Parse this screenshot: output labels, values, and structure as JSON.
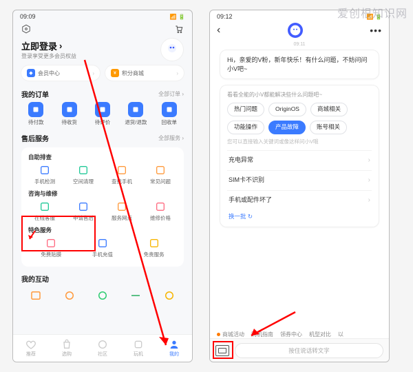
{
  "watermark": "爱创根知识网",
  "phone1": {
    "status": {
      "time": "09:09",
      "icons": "◎ ⇅ ✱ ⊕"
    },
    "login": {
      "title": "立即登录",
      "subtitle": "登录享受更多会员权益"
    },
    "pills": {
      "member": "会员中心",
      "points": "积分商城"
    },
    "orders": {
      "title": "我的订单",
      "more": "全部订单 ›",
      "items": [
        {
          "label": "待付款"
        },
        {
          "label": "待收货"
        },
        {
          "label": "待评价"
        },
        {
          "label": "退货/退款"
        },
        {
          "label": "回收单"
        }
      ]
    },
    "aftersale": {
      "title": "售后服务",
      "more": "全部服务 ›",
      "group1_title": "自助排查",
      "group1": [
        {
          "label": "手机检测"
        },
        {
          "label": "空间清理"
        },
        {
          "label": "查找手机"
        },
        {
          "label": "常见问题"
        }
      ],
      "group2_title": "咨询与维修",
      "group2": [
        {
          "label": "在线客服"
        },
        {
          "label": "申请售后"
        },
        {
          "label": "服务网点"
        },
        {
          "label": "维修价格"
        }
      ],
      "group3_title": "特色服务",
      "group3": [
        {
          "label": "免费贴膜"
        },
        {
          "label": "手机充值"
        },
        {
          "label": "免责服务"
        }
      ]
    },
    "interaction": {
      "title": "我的互动"
    },
    "tabs": [
      {
        "label": "推荐"
      },
      {
        "label": "选购"
      },
      {
        "label": "社区"
      },
      {
        "label": "玩机"
      },
      {
        "label": "我的"
      }
    ]
  },
  "phone2": {
    "status": {
      "time": "09:12",
      "icons": "◎ ⇅ ✱ ⊕"
    },
    "chat_time": "09:11",
    "greeting": "Hi，亲爱的V粉，新年快乐！有什么问题，不妨问问小V吧~",
    "panel": {
      "head": "看看全能的小V都能解决些什么问题吧~",
      "chips": [
        {
          "label": "热门问题"
        },
        {
          "label": "OriginOS"
        },
        {
          "label": "商城相关"
        },
        {
          "label": "功能操作"
        },
        {
          "label": "产品故障",
          "active": true
        },
        {
          "label": "账号相关"
        }
      ],
      "hint": "您可以直接输入关键词或像这样问小V哦",
      "questions": [
        "充电异常",
        "SIM卡不识别",
        "手机或配件坏了"
      ],
      "refresh": "换一批 ↻"
    },
    "quicklinks": [
      "商城活动",
      "购机指南",
      "领券中心",
      "机型对比",
      "以"
    ],
    "input_placeholder": "按住说话转文字"
  }
}
